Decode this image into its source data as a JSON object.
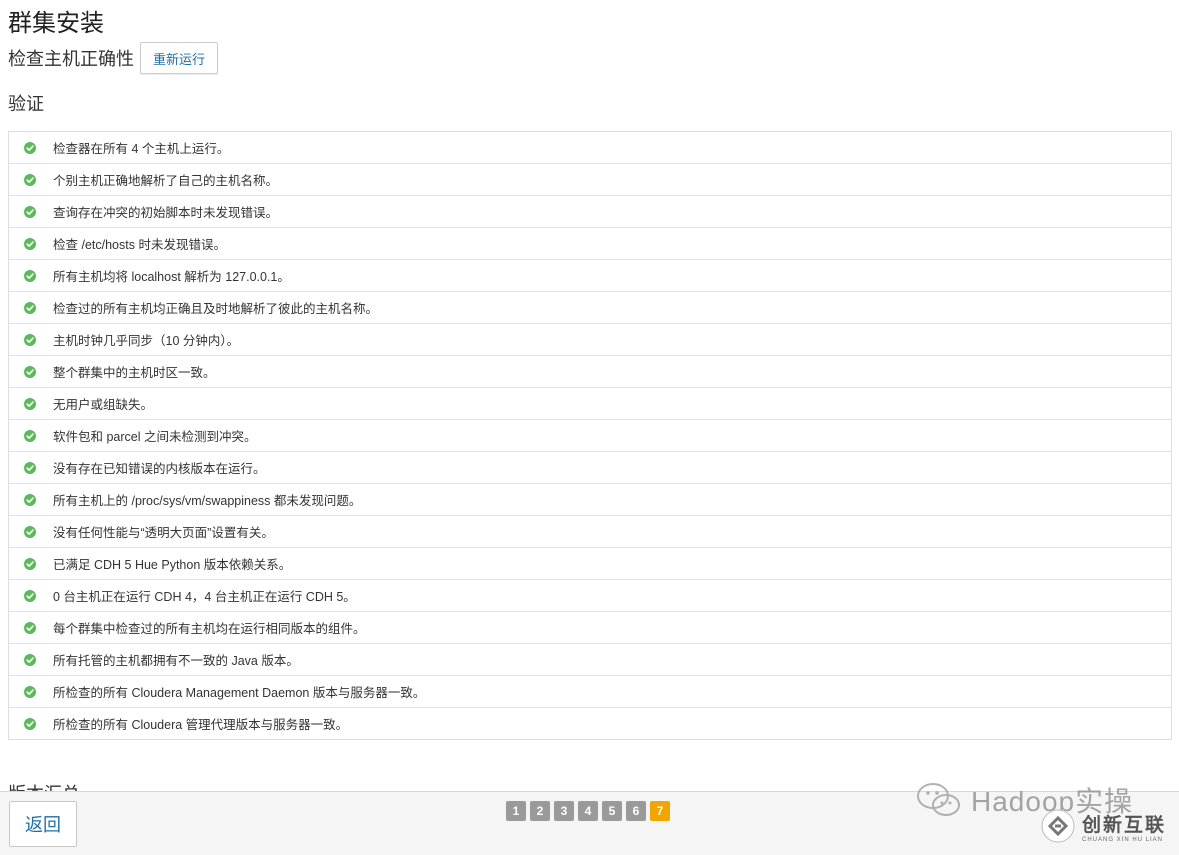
{
  "page": {
    "title": "群集安装",
    "subhead": "检查主机正确性",
    "rerun_label": "重新运行",
    "section_title": "验证",
    "next_section_title": "版本汇总"
  },
  "checks": [
    "检查器在所有 4 个主机上运行。",
    "个别主机正确地解析了自己的主机名称。",
    "查询存在冲突的初始脚本时未发现错误。",
    "检查 /etc/hosts 时未发现错误。",
    "所有主机均将 localhost 解析为 127.0.0.1。",
    "检查过的所有主机均正确且及时地解析了彼此的主机名称。",
    "主机时钟几乎同步（10 分钟内）。",
    "整个群集中的主机时区一致。",
    "无用户或组缺失。",
    "软件包和 parcel 之间未检测到冲突。",
    "没有存在已知错误的内核版本在运行。",
    "所有主机上的 /proc/sys/vm/swappiness 都未发现问题。",
    "没有任何性能与“透明大页面”设置有关。",
    "已满足 CDH 5 Hue Python 版本依赖关系。",
    "0 台主机正在运行 CDH 4，4 台主机正在运行 CDH 5。",
    "每个群集中检查过的所有主机均在运行相同版本的组件。",
    "所有托管的主机都拥有不一致的 Java 版本。",
    "所检查的所有 Cloudera Management Daemon 版本与服务器一致。",
    "所检查的所有 Cloudera 管理代理版本与服务器一致。"
  ],
  "footer": {
    "back_label": "返回",
    "steps": [
      "1",
      "2",
      "3",
      "4",
      "5",
      "6",
      "7"
    ],
    "active_step": "7"
  },
  "watermarks": {
    "wechat_text": "Hadoop实操",
    "brand_cn": "创新互联",
    "brand_en": "CHUANG XIN HU LIAN"
  },
  "colors": {
    "ok": "#5cb85c",
    "link": "#1f6fa8",
    "active_step": "#f0a500",
    "step": "#9a9a9a"
  }
}
